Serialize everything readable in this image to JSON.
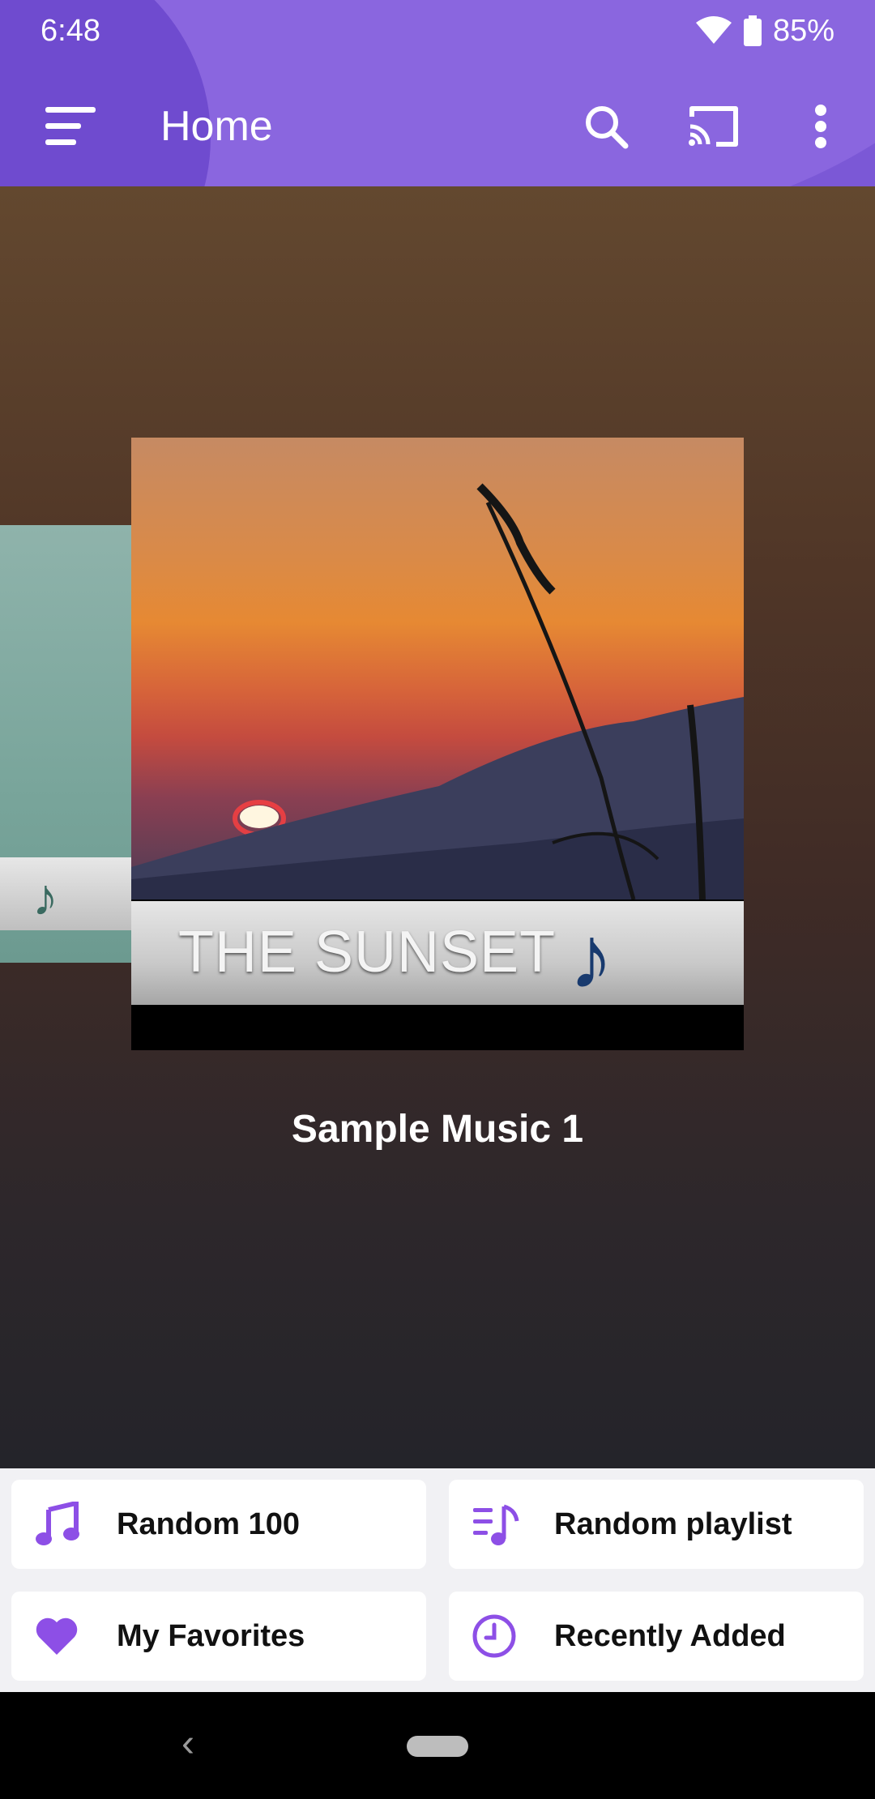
{
  "status_bar": {
    "time": "6:48",
    "battery": "85%"
  },
  "app_bar": {
    "title": "Home",
    "icons": [
      "menu-icon",
      "search-icon",
      "cast-icon",
      "more-vert-icon"
    ]
  },
  "carousel": {
    "current_album": {
      "cover_text": "THE SUNSET",
      "title": "Sample Music 1"
    }
  },
  "quick_actions": [
    {
      "label": "Random 100",
      "icon": "music-note-icon"
    },
    {
      "label": "Random playlist",
      "icon": "playlist-music-icon"
    },
    {
      "label": "My Favorites",
      "icon": "heart-icon"
    },
    {
      "label": "Recently Added",
      "icon": "clock-icon"
    }
  ],
  "colors": {
    "accent": "#7b58d6",
    "icon_purple": "#8d4fe6"
  },
  "nav": {
    "back_glyph": "‹"
  }
}
